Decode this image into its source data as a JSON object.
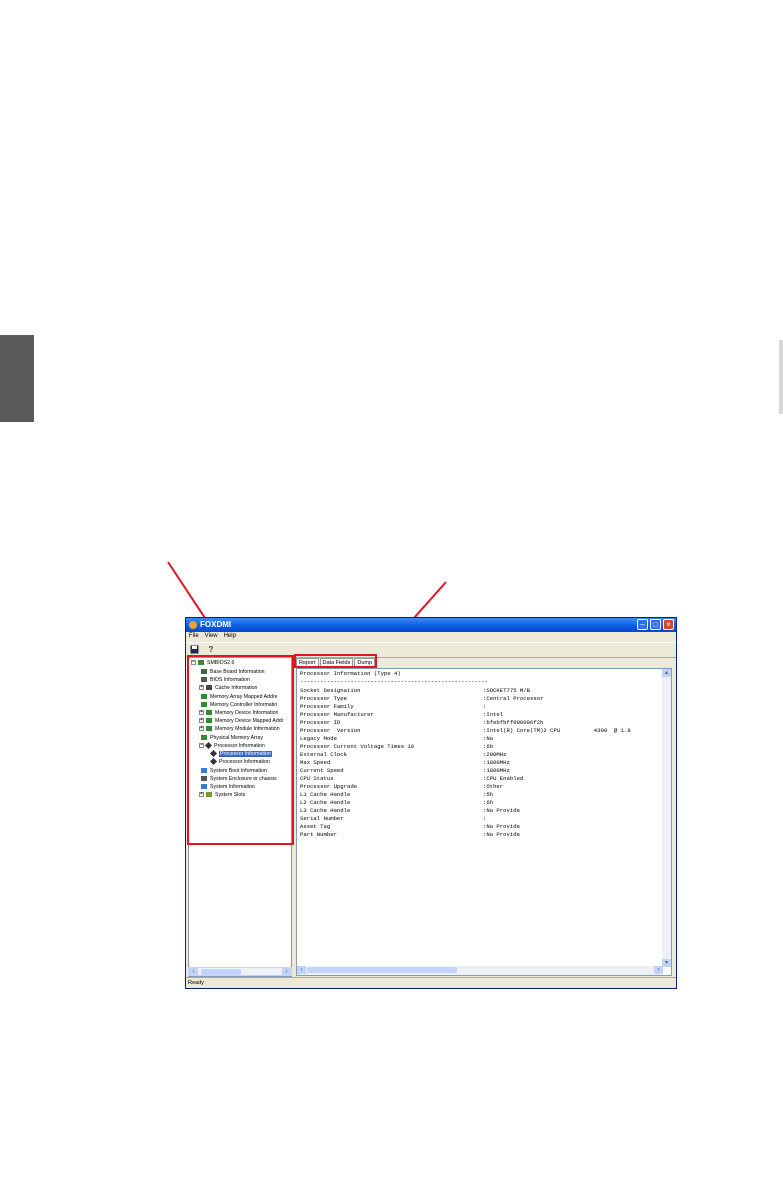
{
  "window": {
    "title": "FOXDMI",
    "controls": [
      "minimize",
      "maximize",
      "close"
    ]
  },
  "menu": [
    "File",
    "View",
    "Help"
  ],
  "toolbar": {
    "icons": [
      "save-icon",
      "help-icon"
    ]
  },
  "tree": {
    "root": "SMBIOS2.6",
    "items": [
      {
        "label": "Base Board Information",
        "expandable": false
      },
      {
        "label": "BIOS Information",
        "expandable": false
      },
      {
        "label": "Cache Information",
        "expandable": true
      },
      {
        "label": "Memory Array Mapped Addre",
        "expandable": false
      },
      {
        "label": "Memory Controller Informatio",
        "expandable": false
      },
      {
        "label": "Memory Device Information",
        "expandable": true
      },
      {
        "label": "Memory Device Mapped Addr",
        "expandable": true
      },
      {
        "label": "Memory Module Information",
        "expandable": true
      },
      {
        "label": "Physical Memory Array",
        "expandable": false
      },
      {
        "label": "Processor Information",
        "expandable": true
      },
      {
        "label": "Processor Information",
        "expandable": false
      },
      {
        "label": "Processor Information",
        "expandable": false
      },
      {
        "label": "System Boot Information",
        "expandable": false
      },
      {
        "label": "System Enclosure or chassis",
        "expandable": false
      },
      {
        "label": "System Information",
        "expandable": false
      },
      {
        "label": "System Slots",
        "expandable": true
      }
    ]
  },
  "tabs": [
    "Report",
    "Data Fields",
    "Dump"
  ],
  "report": {
    "header": "Processor Information (Type 4)",
    "separator": "--------------------------------------------------------",
    "rows": [
      {
        "key": "Socket Designation",
        "value": ":SOCKET775 M/B"
      },
      {
        "key": "Processor Type",
        "value": ":Central Processor"
      },
      {
        "key": "Processor Family",
        "value": ":"
      },
      {
        "key": "Processor Manufacturer",
        "value": ":Intel"
      },
      {
        "key": "Processor ID",
        "value": ":bfebfbff000006f2h"
      },
      {
        "key": "Processor  Version",
        "value": ":Intel(R) Core(TM)2 CPU          4300  @ 1.8"
      },
      {
        "key": "Legacy Mode",
        "value": ":No"
      },
      {
        "key": "Processor Current Voltage Times 10",
        "value": ":6b"
      },
      {
        "key": "External Clock",
        "value": ":200MHz"
      },
      {
        "key": "Max Speed",
        "value": ":1800MHz"
      },
      {
        "key": "Current Speed",
        "value": ":1800MHz"
      },
      {
        "key": "CPU Status",
        "value": ":CPU Enabled"
      },
      {
        "key": "Processor Upgrade",
        "value": ":Other"
      },
      {
        "key": "L1 Cache Handle",
        "value": ":5h"
      },
      {
        "key": "L2 Cache Handle",
        "value": ":6h"
      },
      {
        "key": "L3 Cache Handle",
        "value": ":No Provide"
      },
      {
        "key": "Serial Number",
        "value": ":"
      },
      {
        "key": "Asset Tag",
        "value": ":No Provide"
      },
      {
        "key": "Part Number",
        "value": ":No Provide"
      }
    ]
  },
  "status": "Ready",
  "annotation_color": "#e5141e"
}
